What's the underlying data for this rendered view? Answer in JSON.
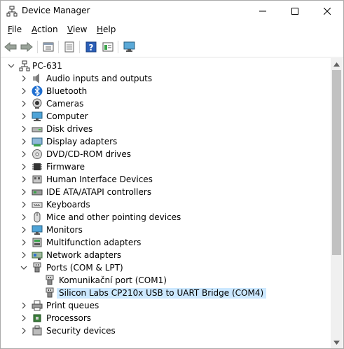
{
  "window": {
    "title": "Device Manager"
  },
  "menu": [
    {
      "accel": "F",
      "rest": "ile"
    },
    {
      "accel": "A",
      "rest": "ction"
    },
    {
      "accel": "V",
      "rest": "iew"
    },
    {
      "accel": "H",
      "rest": "elp"
    }
  ],
  "toolbar": [
    "back-icon",
    "forward-icon",
    "properties-icon",
    "update-driver-icon",
    "help-icon",
    "view-icon",
    "scan-hardware-icon"
  ],
  "tree": {
    "root": "PC-631",
    "items": [
      {
        "label": "Audio inputs and outputs",
        "icon": "speaker-icon"
      },
      {
        "label": "Bluetooth",
        "icon": "bluetooth-icon"
      },
      {
        "label": "Cameras",
        "icon": "camera-icon"
      },
      {
        "label": "Computer",
        "icon": "computer-icon"
      },
      {
        "label": "Disk drives",
        "icon": "disk-drive-icon"
      },
      {
        "label": "Display adapters",
        "icon": "display-adapter-icon"
      },
      {
        "label": "DVD/CD-ROM drives",
        "icon": "dvd-icon"
      },
      {
        "label": "Firmware",
        "icon": "firmware-icon"
      },
      {
        "label": "Human Interface Devices",
        "icon": "hid-icon"
      },
      {
        "label": "IDE ATA/ATAPI controllers",
        "icon": "ide-controller-icon"
      },
      {
        "label": "Keyboards",
        "icon": "keyboard-icon"
      },
      {
        "label": "Mice and other pointing devices",
        "icon": "mouse-icon"
      },
      {
        "label": "Monitors",
        "icon": "monitor-icon"
      },
      {
        "label": "Multifunction adapters",
        "icon": "multifunction-icon"
      },
      {
        "label": "Network adapters",
        "icon": "network-adapter-icon"
      },
      {
        "label": "Ports (COM & LPT)",
        "icon": "port-icon",
        "expanded": true
      },
      {
        "label": "Komunikační port (COM1)",
        "icon": "port-icon",
        "child": true
      },
      {
        "label": "Silicon Labs CP210x USB to UART Bridge (COM4)",
        "icon": "port-icon",
        "child": true,
        "selected": true
      },
      {
        "label": "Print queues",
        "icon": "printer-icon"
      },
      {
        "label": "Processors",
        "icon": "processor-icon"
      },
      {
        "label": "Security devices",
        "icon": "security-icon"
      }
    ]
  },
  "colors": {
    "selection": "#cce8ff",
    "scrollbar_thumb": "#c1c1c1"
  }
}
